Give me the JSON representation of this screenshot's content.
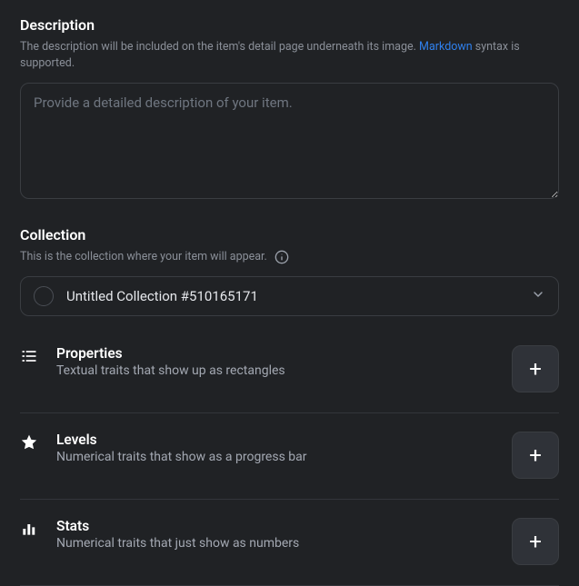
{
  "description": {
    "title": "Description",
    "help_pre": "The description will be included on the item's detail page underneath its image. ",
    "help_link": "Markdown",
    "help_post": " syntax is supported.",
    "placeholder": "Provide a detailed description of your item."
  },
  "collection": {
    "title": "Collection",
    "help": "This is the collection where your item will appear.",
    "selected": "Untitled Collection #510165171"
  },
  "traits": {
    "properties": {
      "title": "Properties",
      "sub": "Textual traits that show up as rectangles",
      "add": "+"
    },
    "levels": {
      "title": "Levels",
      "sub": "Numerical traits that show as a progress bar",
      "add": "+"
    },
    "stats": {
      "title": "Stats",
      "sub": "Numerical traits that just show as numbers",
      "add": "+"
    }
  }
}
